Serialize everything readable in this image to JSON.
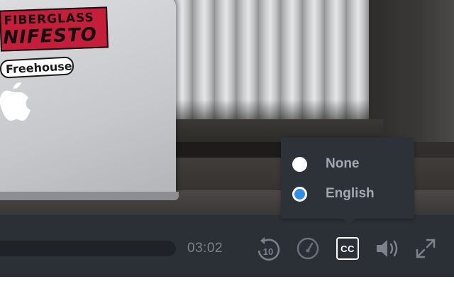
{
  "video": {
    "sticker_red_line1": "FIBERGLASS",
    "sticker_red_line2": "NIFESTO",
    "sticker_white": "Freehouse"
  },
  "controls": {
    "time": "03:02",
    "rewind_number": "10",
    "cc_label": "CC",
    "icons": [
      "rewind-10-icon",
      "playback-speed-icon",
      "closed-captions-icon",
      "volume-icon",
      "fullscreen-icon"
    ]
  },
  "captions_menu": {
    "options": [
      {
        "label": "None",
        "selected": false
      },
      {
        "label": "English",
        "selected": true
      }
    ]
  },
  "colors": {
    "control_bar": "#2b3036",
    "menu_bg": "#2d3238",
    "accent_blue": "#2f8ee6",
    "icon_gray": "#7c828a",
    "label_gray": "#a3a9b1"
  }
}
